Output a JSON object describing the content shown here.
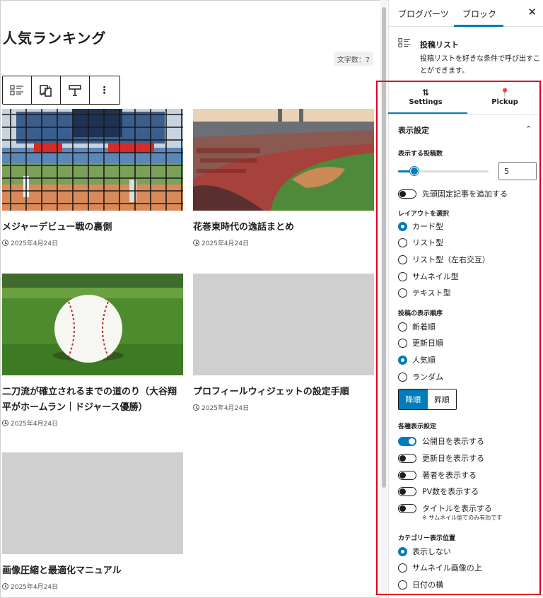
{
  "editor": {
    "page_title": "人気ランキング",
    "word_count": "文字数：7",
    "cards": [
      {
        "title": "メジャーデビュー戦の裏側",
        "date": "2025年4月24日",
        "thumb": "baseball-net-image"
      },
      {
        "title": "花巻東時代の逸話まとめ",
        "date": "2025年4月24日",
        "thumb": "stadium-image"
      },
      {
        "title": "二刀流が確立されるまでの道のり（大谷翔平がホームラン｜ドジャース優勝）",
        "date": "2025年4月24日",
        "thumb": "baseball-on-grass-image"
      },
      {
        "title": "プロフィールウィジェットの設定手順",
        "date": "2025年4月24日",
        "thumb": "gray-placeholder"
      },
      {
        "title": "画像圧縮と最適化マニュアル",
        "date": "2025年4月24日",
        "thumb": "gray-placeholder"
      }
    ]
  },
  "sidebar": {
    "tab_parts": "ブログパーツ",
    "tab_block": "ブロック",
    "block_name": "投稿リスト",
    "block_desc": "投稿リストを好きな条件で呼び出すことができます。",
    "settings_tab": "Settings",
    "pickup_tab": "Pickup",
    "panel_title": "表示設定",
    "count_label": "表示する投稿数",
    "count_value": "5",
    "count_fraction": 0.18,
    "sticky_label": "先頭固定記事を追加する",
    "layout_label": "レイアウトを選択",
    "layouts": [
      "カード型",
      "リスト型",
      "リスト型（左右交互）",
      "サムネイル型",
      "テキスト型"
    ],
    "layout_selected": 0,
    "order_label": "投稿の表示順序",
    "orders": [
      "新着順",
      "更新日順",
      "人気順",
      "ランダム"
    ],
    "order_selected": 2,
    "desc_btn": "降順",
    "asc_btn": "昇順",
    "display_label": "各種表示設定",
    "toggles": [
      {
        "label": "公開日を表示する",
        "on": true
      },
      {
        "label": "更新日を表示する",
        "on": false
      },
      {
        "label": "著者を表示する",
        "on": false
      },
      {
        "label": "PV数を表示する",
        "on": false
      },
      {
        "label": "タイトルを表示する",
        "on": false
      }
    ],
    "title_note": "※ サムネイル型でのみ有効です",
    "category_label": "カテゴリー表示位置",
    "category_options": [
      "表示しない",
      "サムネイル画像の上",
      "日付の横"
    ],
    "category_selected": 0
  },
  "colors": {
    "accent": "#007cba",
    "highlight": "#e0001b"
  }
}
